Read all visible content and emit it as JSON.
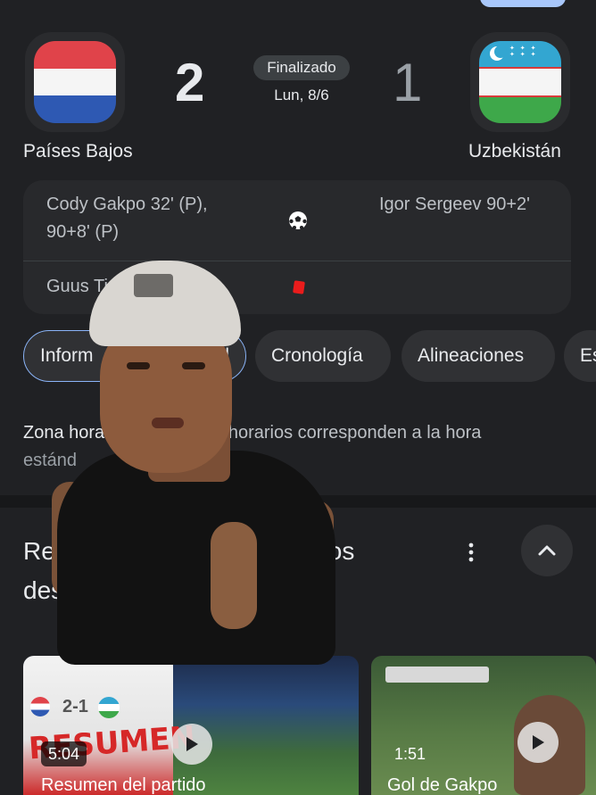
{
  "match": {
    "home": {
      "name": "Países Bajos",
      "score": "2",
      "flag_colors": [
        "#e0434a",
        "#f5f5f5",
        "#2e59b3"
      ]
    },
    "away": {
      "name": "Uzbekistán",
      "score": "1",
      "flag_colors": [
        "#33a6d1",
        "#f5f5f5",
        "#3ea84a"
      ]
    },
    "status": "Finalizado",
    "date": "Lun, 8/6"
  },
  "events": {
    "home_goals_line1": "Cody Gakpo 32' (P),",
    "home_goals_line2": "90+8' (P)",
    "away_goals": "Igor Sergeev 90+2'",
    "home_red_card": "Guus Ti",
    "goal_icon": "soccer-ball-icon",
    "card_icon": "red-card-icon"
  },
  "tabs": [
    {
      "label": "Inform"
    },
    {
      "label": "l"
    },
    {
      "label": "Cronología"
    },
    {
      "label": "Alineaciones"
    },
    {
      "label": "Es"
    }
  ],
  "timezone": {
    "label": "Zona hora",
    "text": "os horarios corresponden a la hora",
    "line2": "estánd"
  },
  "highlights": {
    "title_line1_a": "Re",
    "title_line1_b": "os",
    "title_line2": "des",
    "more_icon": "more-vert-icon",
    "collapse_icon": "chevron-up-icon",
    "videos": [
      {
        "title": "Resumen del partido",
        "duration": "5:04",
        "overlay_text": "RESUMEN",
        "mini_score": "2-1"
      },
      {
        "title": "Gol de Gakpo",
        "duration": "1:51"
      }
    ]
  }
}
